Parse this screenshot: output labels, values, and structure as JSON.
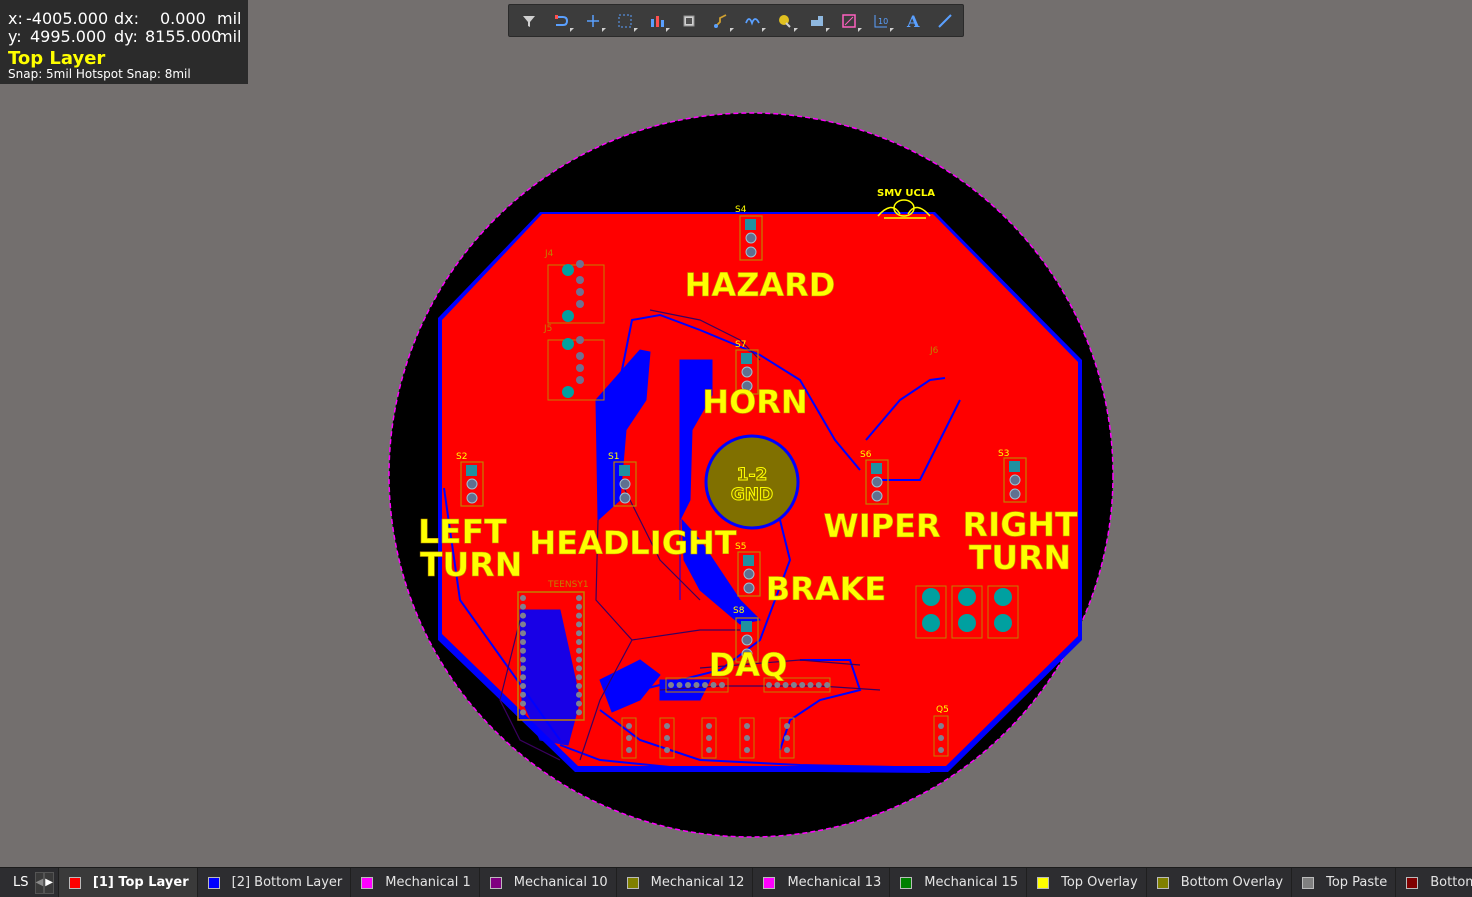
{
  "hud": {
    "x_label": "x:",
    "x_value": "-4005.000",
    "dx_label": "dx:",
    "dx_value": "0.000",
    "unit1": "mil",
    "y_label": "y:",
    "y_value": "4995.000",
    "dy_label": "dy:",
    "dy_value": "8155.000",
    "unit2": "mil",
    "layer": "Top Layer",
    "snap": "Snap: 5mil Hotspot Snap: 8mil"
  },
  "toolbar": {
    "tools": [
      {
        "name": "filter-icon",
        "has_dropdown": false
      },
      {
        "name": "route-icon",
        "has_dropdown": true
      },
      {
        "name": "crosshair-icon",
        "has_dropdown": true
      },
      {
        "name": "select-rect-icon",
        "has_dropdown": true
      },
      {
        "name": "align-icon",
        "has_dropdown": true
      },
      {
        "name": "component-icon",
        "has_dropdown": false
      },
      {
        "name": "interactive-route-icon",
        "has_dropdown": true
      },
      {
        "name": "diff-pair-icon",
        "has_dropdown": true
      },
      {
        "name": "via-icon",
        "has_dropdown": true
      },
      {
        "name": "polygon-icon",
        "has_dropdown": true
      },
      {
        "name": "keepout-icon",
        "has_dropdown": true
      },
      {
        "name": "dimension-icon",
        "has_dropdown": true
      },
      {
        "name": "text-icon",
        "has_dropdown": false
      },
      {
        "name": "line-icon",
        "has_dropdown": false
      }
    ]
  },
  "pcb": {
    "labels": {
      "hazard": "HAZARD",
      "horn": "HORN",
      "left1": "LEFT",
      "left2": "TURN",
      "headlight": "HEADLIGHT",
      "wiper": "WIPER",
      "right1": "RIGHT",
      "right2": "TURN",
      "brake": "BRAKE",
      "daq": "DAQ",
      "logo": "SMV UCLA",
      "mount1": "1-2",
      "mount2": "GND"
    },
    "designators": {
      "s4": "S4",
      "s7": "S7",
      "s2": "S2",
      "s1": "S1",
      "s6": "S6",
      "s3": "S3",
      "s5": "S5",
      "s8": "S8",
      "j4": "J4",
      "j5": "J5",
      "j6": "J6",
      "teensy": "TEENSY1",
      "q5": "Q5"
    },
    "colors": {
      "top_layer": "#ff0000",
      "bottom_layer": "#0000ff",
      "top_overlay": "#ffff00",
      "board_edge": "#ff00ff",
      "background": "#736f6e",
      "board_black": "#000000",
      "pad": "#00a0a0",
      "mount": "#807000"
    }
  },
  "status": {
    "ls_label": "LS",
    "prev": "◀",
    "next": "▶",
    "layers": [
      {
        "label": "[1] Top Layer",
        "color": "#ff0000",
        "active": true
      },
      {
        "label": "[2] Bottom Layer",
        "color": "#0000ff",
        "active": false
      },
      {
        "label": "Mechanical 1",
        "color": "#ff00ff",
        "active": false
      },
      {
        "label": "Mechanical 10",
        "color": "#800080",
        "active": false
      },
      {
        "label": "Mechanical 12",
        "color": "#808000",
        "active": false
      },
      {
        "label": "Mechanical 13",
        "color": "#ff00ff",
        "active": false
      },
      {
        "label": "Mechanical 15",
        "color": "#008000",
        "active": false
      },
      {
        "label": "Top Overlay",
        "color": "#ffff00",
        "active": false
      },
      {
        "label": "Bottom Overlay",
        "color": "#808000",
        "active": false
      },
      {
        "label": "Top Paste",
        "color": "#808080",
        "active": false
      },
      {
        "label": "Bottom Paste",
        "color": "#800000",
        "active": false
      }
    ]
  }
}
